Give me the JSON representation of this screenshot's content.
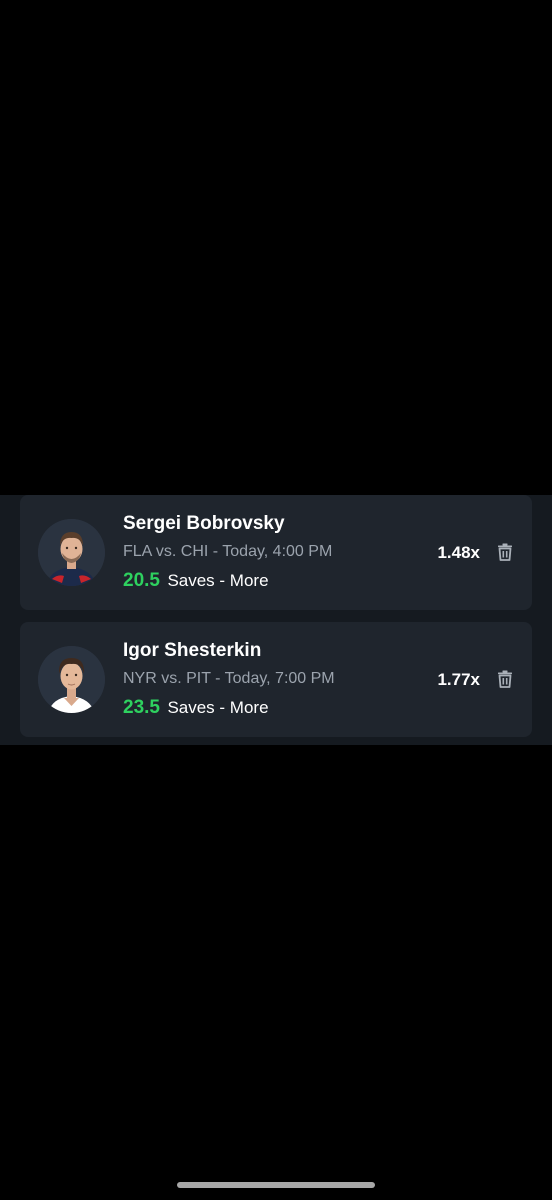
{
  "picks": [
    {
      "player_name": "Sergei Bobrovsky",
      "matchup": "FLA vs. CHI - Today, 4:00 PM",
      "line": "20.5",
      "stat_label": "Saves - More",
      "multiplier": "1.48x"
    },
    {
      "player_name": "Igor Shesterkin",
      "matchup": "NYR vs. PIT - Today, 7:00 PM",
      "line": "23.5",
      "stat_label": "Saves - More",
      "multiplier": "1.77x"
    }
  ],
  "colors": {
    "background": "#000000",
    "panel": "#151a20",
    "card": "#1f252d",
    "line_green": "#2ed15f",
    "secondary_text": "#9ba3ad"
  },
  "icons": {
    "delete": "trash-icon"
  }
}
